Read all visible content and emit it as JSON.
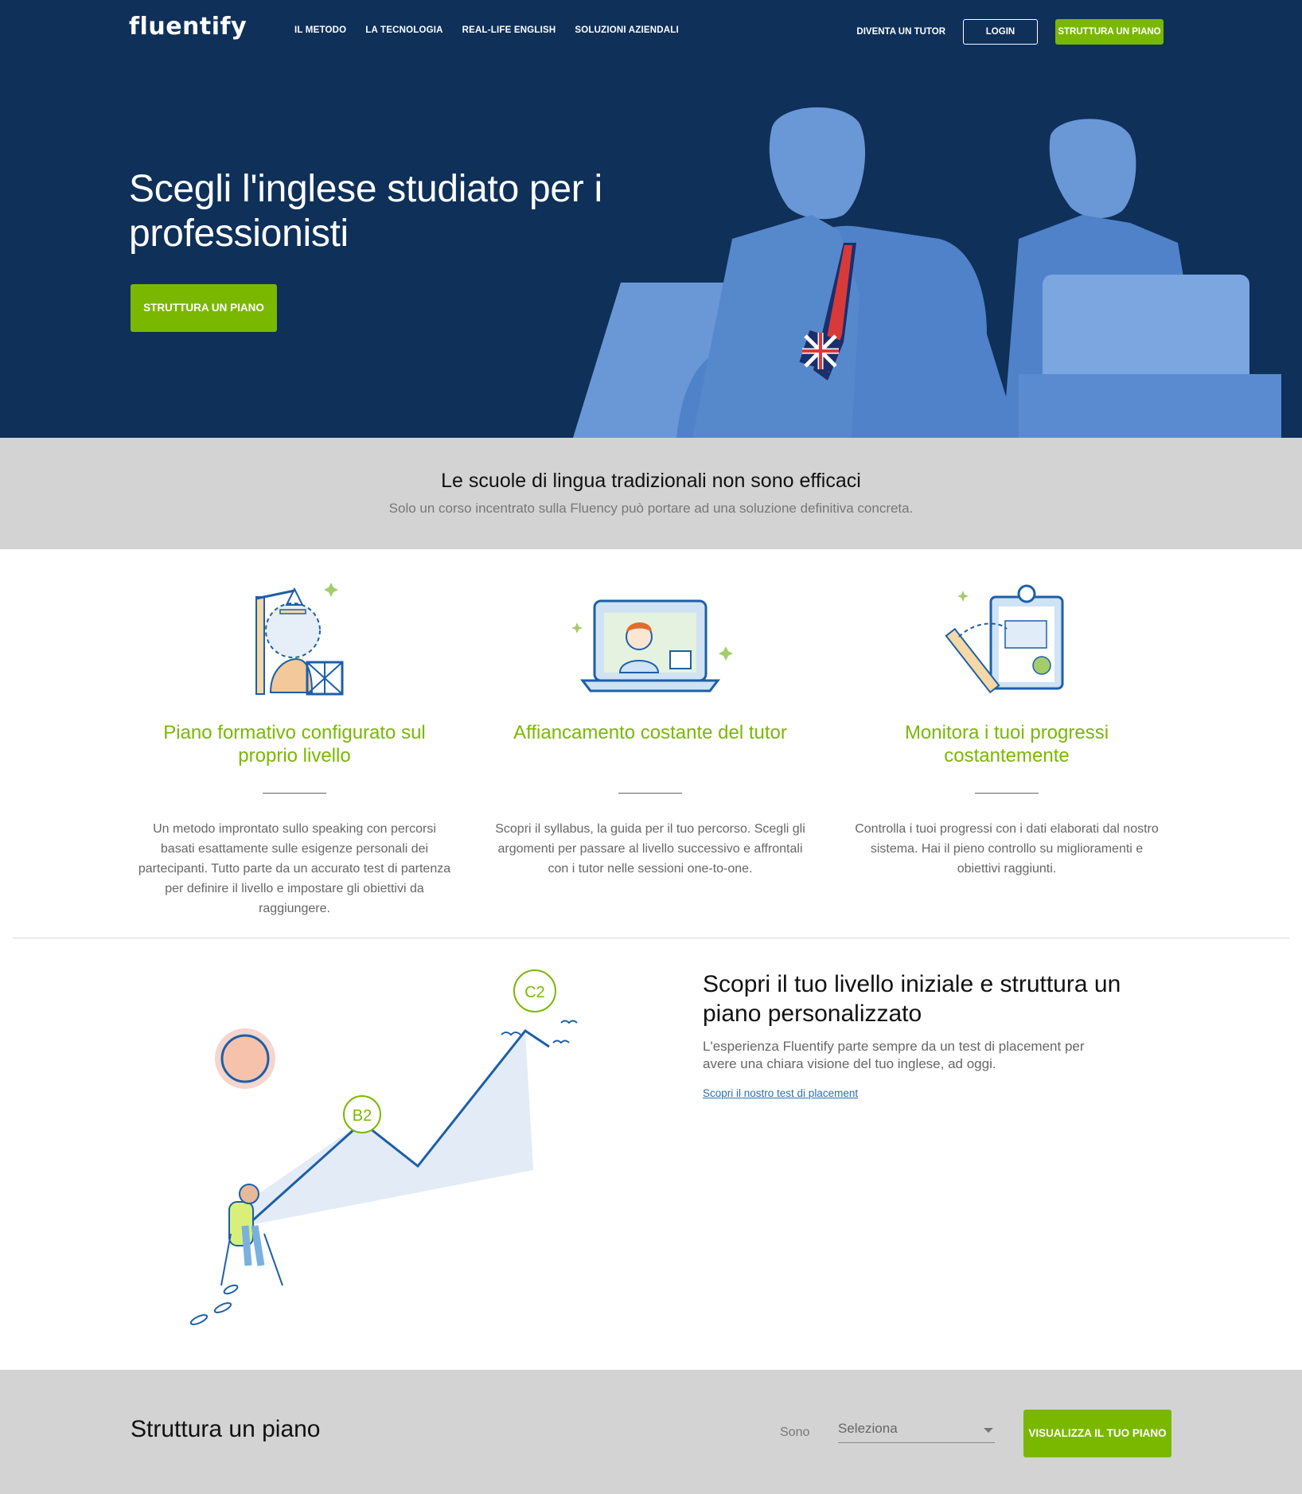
{
  "brand": {
    "logo": "fluentify",
    "accent": "#7ab800",
    "navy": "#0e3059"
  },
  "nav": {
    "links": [
      "IL METODO",
      "LA TECNOLOGIA",
      "REAL-LIFE ENGLISH",
      "SOLUZIONI AZIENDALI"
    ],
    "tutor": "DIVENTA UN TUTOR",
    "login": "LOGIN",
    "cta": "STRUTTURA UN PIANO"
  },
  "hero": {
    "title": "Scegli l'inglese studiato per i professionisti",
    "cta": "STRUTTURA UN PIANO"
  },
  "band": {
    "title": "Le scuole di lingua tradizionali non sono efficaci",
    "subtitle": "Solo un corso incentrato sulla Fluency può portare ad una soluzione definitiva concreta."
  },
  "features": [
    {
      "icon": "crane-head-icon",
      "title": "Piano formativo configurato sul proprio livello",
      "text": "Un metodo improntato sullo speaking con percorsi basati esattamente sulle esigenze personali dei partecipanti. Tutto parte da un accurato test di partenza per definire il livello e impostare gli obiettivi da raggiungere."
    },
    {
      "icon": "laptop-tutor-icon",
      "title": "Affiancamento costante del tutor",
      "text": "Scopri il syllabus, la guida per il tuo percorso. Scegli gli argomenti per passare al livello successivo e affrontali con i tutor nelle sessioni one-to-one."
    },
    {
      "icon": "clipboard-chart-icon",
      "title": "Monitora i tuoi progressi costantemente",
      "text": "Controlla i tuoi progressi con i dati elaborati dal nostro sistema. Hai il pieno controllo su miglioramenti e obiettivi raggiunti."
    }
  ],
  "placement": {
    "title": "Scopri il tuo livello iniziale e struttura un piano personalizzato",
    "text": "L'esperienza Fluentify parte sempre da un test di placement per avere una chiara visione del tuo inglese, ad oggi.",
    "link": "Scopri il nostro test di placement",
    "levels": [
      "B2",
      "C2"
    ]
  },
  "plan": {
    "title": "Struttura un piano",
    "label": "Sono",
    "select_value": "Seleziona",
    "cta": "VISUALIZZA IL TUO PIANO"
  }
}
